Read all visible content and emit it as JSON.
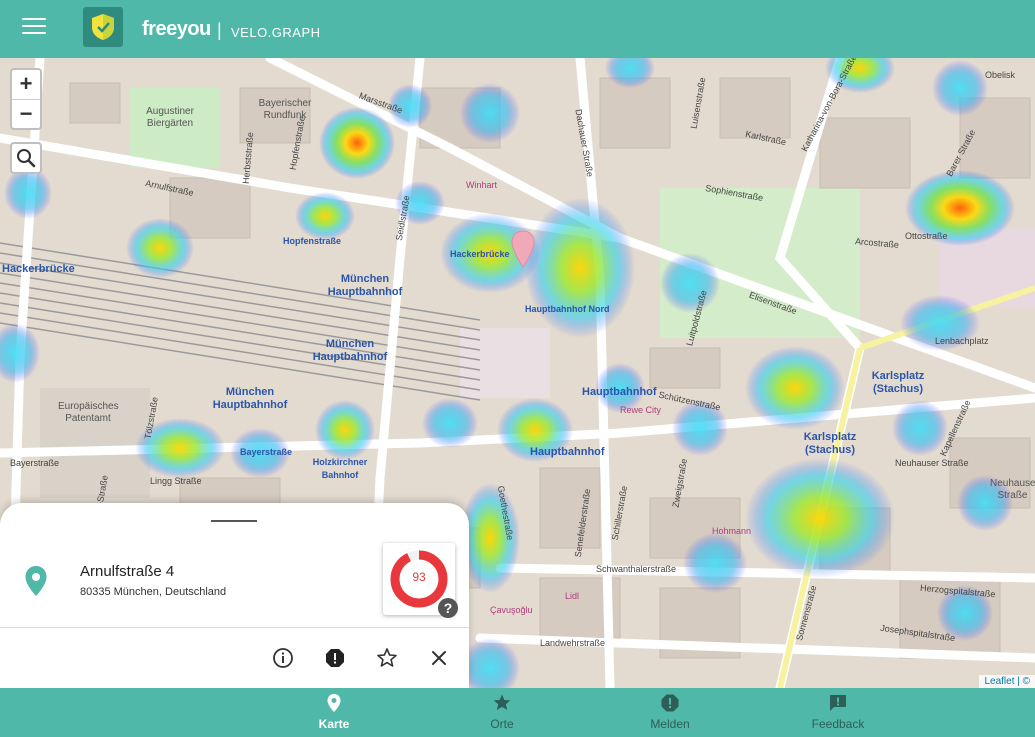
{
  "header": {
    "brand": "freeyou",
    "separator": "|",
    "subbrand": "VELO.GRAPH"
  },
  "map": {
    "zoom_in": "+",
    "zoom_out": "−",
    "attribution": "Leaflet | ©",
    "streets": [
      "Marsstraße",
      "Arnulfstraße",
      "Hopfenstraße",
      "Herbststraße",
      "Seidlstraße",
      "Dachauer Straße",
      "Luisenstraße",
      "Karlstraße",
      "Katharina-von-Bora-Straße",
      "Sophienstraße",
      "Arcostraße",
      "Elisenstraße",
      "Luitpoldstraße",
      "Bayerstraße",
      "Schützenstraße",
      "Neuhauser Straße",
      "Goethestraße",
      "Schillerstraße",
      "Senefelderstraße",
      "Schwanthalerstraße",
      "Landwehrstraße",
      "Josephspitalstraße",
      "Herzogspitalstraße",
      "Zweigstraße",
      "Sonnenstraße",
      "Lingg Straße",
      "Tölzstraße",
      "Paul-Heyse-Straße",
      "Barer Straße",
      "Kapellenstraße",
      "Lenbachplatz",
      "Ottostraße",
      "Hackerbrücke",
      "Marsstraße"
    ],
    "pois": [
      "München Hauptbahnhof",
      "München Hauptbahnhof",
      "München Hauptbahnhof",
      "Hauptbahnhof Nord",
      "Hauptbahnhof",
      "Hauptbahnhof",
      "Karlsplatz (Stachus)",
      "Karlsplatz (Stachus)",
      "Hopfenstraße",
      "Holzkirchner Bahnhof",
      "Bayerstraße",
      "Hackerbrücke"
    ],
    "areas": [
      "Augustiner Biergärten",
      "Bayerischer Rundfunk",
      "Europäisches Patentamt",
      "Neuhauser Straße"
    ],
    "shops": [
      "Winhart",
      "Rewe City",
      "Lidl",
      "Çavuşoğlu",
      "Hohmann",
      "Obelisk"
    ]
  },
  "sheet": {
    "handle": "_____",
    "address_title": "Arnulfstraße 4",
    "address_sub": "80335 München, Deutschland",
    "score": "93",
    "score_fraction": 0.93,
    "help": "?",
    "colors": {
      "score_ring": "#e8383d",
      "pin": "#4fb8a8"
    }
  },
  "nav": {
    "items": [
      {
        "label": "Karte",
        "icon": "map-pin-icon",
        "active": true
      },
      {
        "label": "Orte",
        "icon": "star-icon",
        "active": false
      },
      {
        "label": "Melden",
        "icon": "alert-icon",
        "active": false
      },
      {
        "label": "Feedback",
        "icon": "feedback-icon",
        "active": false
      }
    ]
  },
  "colors": {
    "accent": "#4fb8a8",
    "nav_text": "#2e5e58"
  }
}
